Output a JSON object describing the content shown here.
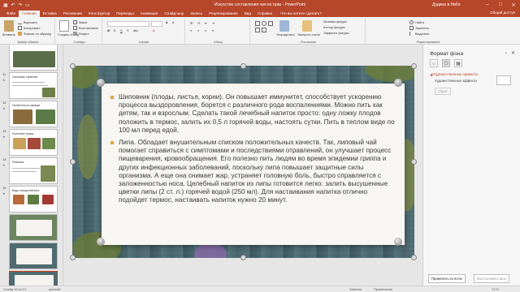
{
  "window": {
    "title": "Искусство составления чая из трав  -  PowerPoint",
    "user": "Дудина в Нибо",
    "qa_icons": [
      "save-icon",
      "undo-icon",
      "redo-icon",
      "slideshow-icon"
    ]
  },
  "tabs": [
    "Файл",
    "Главная",
    "Вставка",
    "Рисование",
    "Конструктор",
    "Переходы",
    "Анимация",
    "Слайд-шоу",
    "Запись",
    "Рецензирование",
    "Вид",
    "Справка"
  ],
  "tell_me": "Что вы хотите сделать?",
  "share": "Общий доступ",
  "ribbon": {
    "paste": "Вставить",
    "cut": "Вырезать",
    "copy": "Копировать",
    "format_painter": "Формат по образцу",
    "clipboard_group": "Буфер обмена",
    "new_slide": "Создать слайд",
    "layout": "Макет",
    "reset": "Восстановить",
    "section": "Раздел",
    "slides_group": "Слайды",
    "font_group": "Шрифт",
    "paragraph_group": "Абзац",
    "drawing_group": "Рисование",
    "arrange": "Упорядочить",
    "quick_styles": "Экспресс-стили",
    "shape_fill": "Заливка фигуры",
    "shape_outline": "Контур фигуры",
    "shape_effects": "Эффекты фигуры",
    "find": "Найти",
    "replace": "Заменить",
    "select": "Выделить",
    "editing_group": "Редактирование"
  },
  "thumbnails": [
    {
      "num": "11",
      "title": "Основные свойства"
    },
    {
      "num": "12",
      "title": "Особенности заварки"
    },
    {
      "num": "13",
      "title": "Полезные травы"
    },
    {
      "num": "14",
      "title": "Ромашка"
    },
    {
      "num": "15",
      "title": "Виды лекарственных"
    },
    {
      "num": "",
      "title": ""
    },
    {
      "num": "",
      "title": ""
    },
    {
      "num": "",
      "title": ""
    },
    {
      "num": "",
      "title": ""
    }
  ],
  "slide": {
    "bullets": [
      "Шиповник (плоды, листья, корни). Он повышает иммунитет, способствует ускорению процесса выздоровления, борется с различного рода воспалениями. Можно пить как детям, так и взрослым. Сделать такой лечебный напиток просто: одну ложку плодов положить в термос, залить их 0,5 л горячей воды, настоять сутки. Пить в теплом виде по 100 мл перед едой.",
      "Липа. Обладает внушительным списком положительных качеств. Так, липовый чай помогает справиться с симптомами и последствиями отравлений, он улучшает процесс пищеварения, кровообращения. Его полезно пить людям во время эпидемии гриппа и других инфекционных заболеваний, поскольку липа повышает защитные силы организма. А еще она снимает жар, устраняет головную боль, быстро справляется с заложенностью носа. Целебный напиток из липы готовится легко: залить высушенные цветки липы (2 ст. л.) горячей водой (250 мл). Для настаивания напитка отлично подойдет термос, настаивать напиток нужно 20 минут."
    ]
  },
  "format_pane": {
    "title": "Формат фона",
    "section": "Художественные эффекты",
    "effects_label": "Художественные эффекты",
    "reset": "Сброс",
    "apply_all": "Применить ко всем",
    "reset_background": "Восстановить фон"
  },
  "status": {
    "slide_info": "Слайд 16 из 21",
    "language": "русский",
    "notes": "Заметки",
    "comments": "Примечания",
    "zoom": "73 %"
  },
  "colors": {
    "accent": "#b7472a",
    "bullet": "#e0a33c"
  }
}
